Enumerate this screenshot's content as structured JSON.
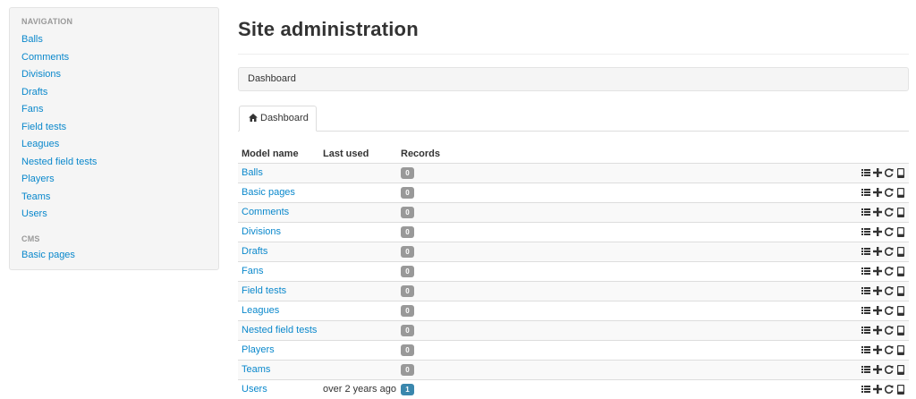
{
  "sidebar": {
    "sections": [
      {
        "header": "NAVIGATION",
        "items": [
          "Balls",
          "Comments",
          "Divisions",
          "Drafts",
          "Fans",
          "Field tests",
          "Leagues",
          "Nested field tests",
          "Players",
          "Teams",
          "Users"
        ]
      },
      {
        "header": "CMS",
        "items": [
          "Basic pages"
        ]
      }
    ]
  },
  "page": {
    "title": "Site administration",
    "breadcrumb": "Dashboard",
    "tab_label": "Dashboard"
  },
  "table": {
    "headers": {
      "model": "Model name",
      "used": "Last used",
      "records": "Records"
    },
    "rows": [
      {
        "name": "Balls",
        "last_used": "",
        "records": "0"
      },
      {
        "name": "Basic pages",
        "last_used": "",
        "records": "0"
      },
      {
        "name": "Comments",
        "last_used": "",
        "records": "0"
      },
      {
        "name": "Divisions",
        "last_used": "",
        "records": "0"
      },
      {
        "name": "Drafts",
        "last_used": "",
        "records": "0"
      },
      {
        "name": "Fans",
        "last_used": "",
        "records": "0"
      },
      {
        "name": "Field tests",
        "last_used": "",
        "records": "0"
      },
      {
        "name": "Leagues",
        "last_used": "",
        "records": "0"
      },
      {
        "name": "Nested field tests",
        "last_used": "",
        "records": "0"
      },
      {
        "name": "Players",
        "last_used": "",
        "records": "0"
      },
      {
        "name": "Teams",
        "last_used": "",
        "records": "0"
      },
      {
        "name": "Users",
        "last_used": "over 2 years ago",
        "records": "1"
      }
    ],
    "row_actions": [
      "list-icon",
      "plus-icon",
      "export-icon",
      "book-icon"
    ]
  },
  "colors": {
    "link": "#0a88cc",
    "badge_default": "#999999",
    "badge_info": "#3a87ad"
  }
}
